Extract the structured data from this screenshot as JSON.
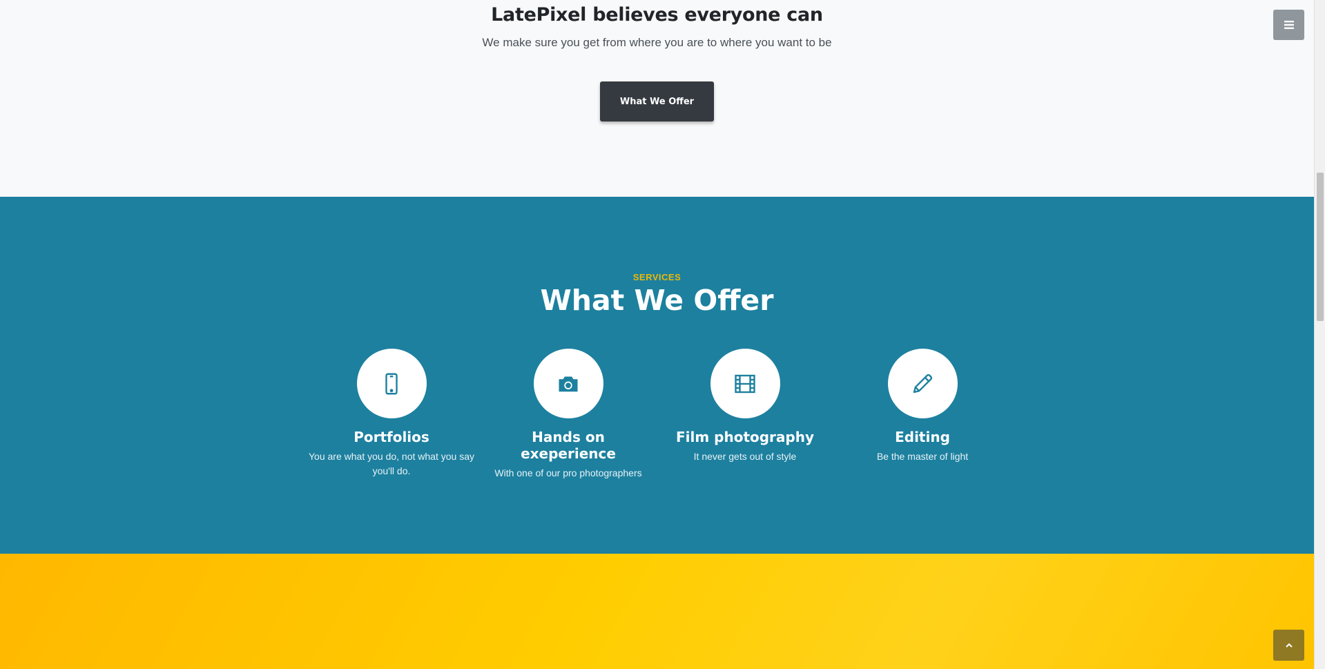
{
  "about": {
    "title": "LatePixel believes everyone can",
    "subtitle": "We make sure you get from where you  are to where you want to be",
    "button_label": "What We Offer"
  },
  "services": {
    "eyebrow": "SERVICES",
    "title": "What We Offer",
    "items": [
      {
        "icon": "mobile-phone-icon",
        "title": "Portfolios",
        "text": "You are what you do, not what you say you'll do."
      },
      {
        "icon": "camera-icon",
        "title": "Hands on exeperience",
        "text": "With one of our pro photographers"
      },
      {
        "icon": "film-icon",
        "title": "Film photography",
        "text": "It never gets out of style"
      },
      {
        "icon": "pencil-icon",
        "title": "Editing",
        "text": "Be the master of light"
      }
    ]
  },
  "colors": {
    "primary": "#1d809f",
    "accent": "#ecb807",
    "dark": "#343a40",
    "light": "#f8f9fa"
  },
  "controls": {
    "menu_toggle": "menu-bars-icon",
    "scroll_to_top": "chevron-up-icon"
  }
}
